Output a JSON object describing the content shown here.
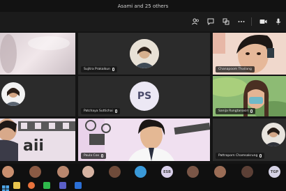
{
  "window": {
    "title": "Asami and 25 others"
  },
  "toolbar": {
    "icons": [
      "people-icon",
      "chat-icon",
      "reactions-icon",
      "more-icon",
      "camera-icon",
      "mic-icon"
    ]
  },
  "tiles": [
    {
      "name": ""
    },
    {
      "name": "Sujitra Prakaikun"
    },
    {
      "name": "Chanapoom Thailang"
    },
    {
      "name": ""
    },
    {
      "name": "Patchaya Suttichai",
      "initials": "PS"
    },
    {
      "name": "Sanija Rungtanasiri"
    },
    {
      "name": ""
    },
    {
      "name": "Paula Cox"
    },
    {
      "name": "Pattraporn Chamsakrung"
    }
  ],
  "slide_text": "aii",
  "participant_strip": {
    "initials": [
      "ESB",
      "TGP"
    ]
  },
  "colors": {
    "accent": "#7b83eb",
    "background": "#141414"
  }
}
